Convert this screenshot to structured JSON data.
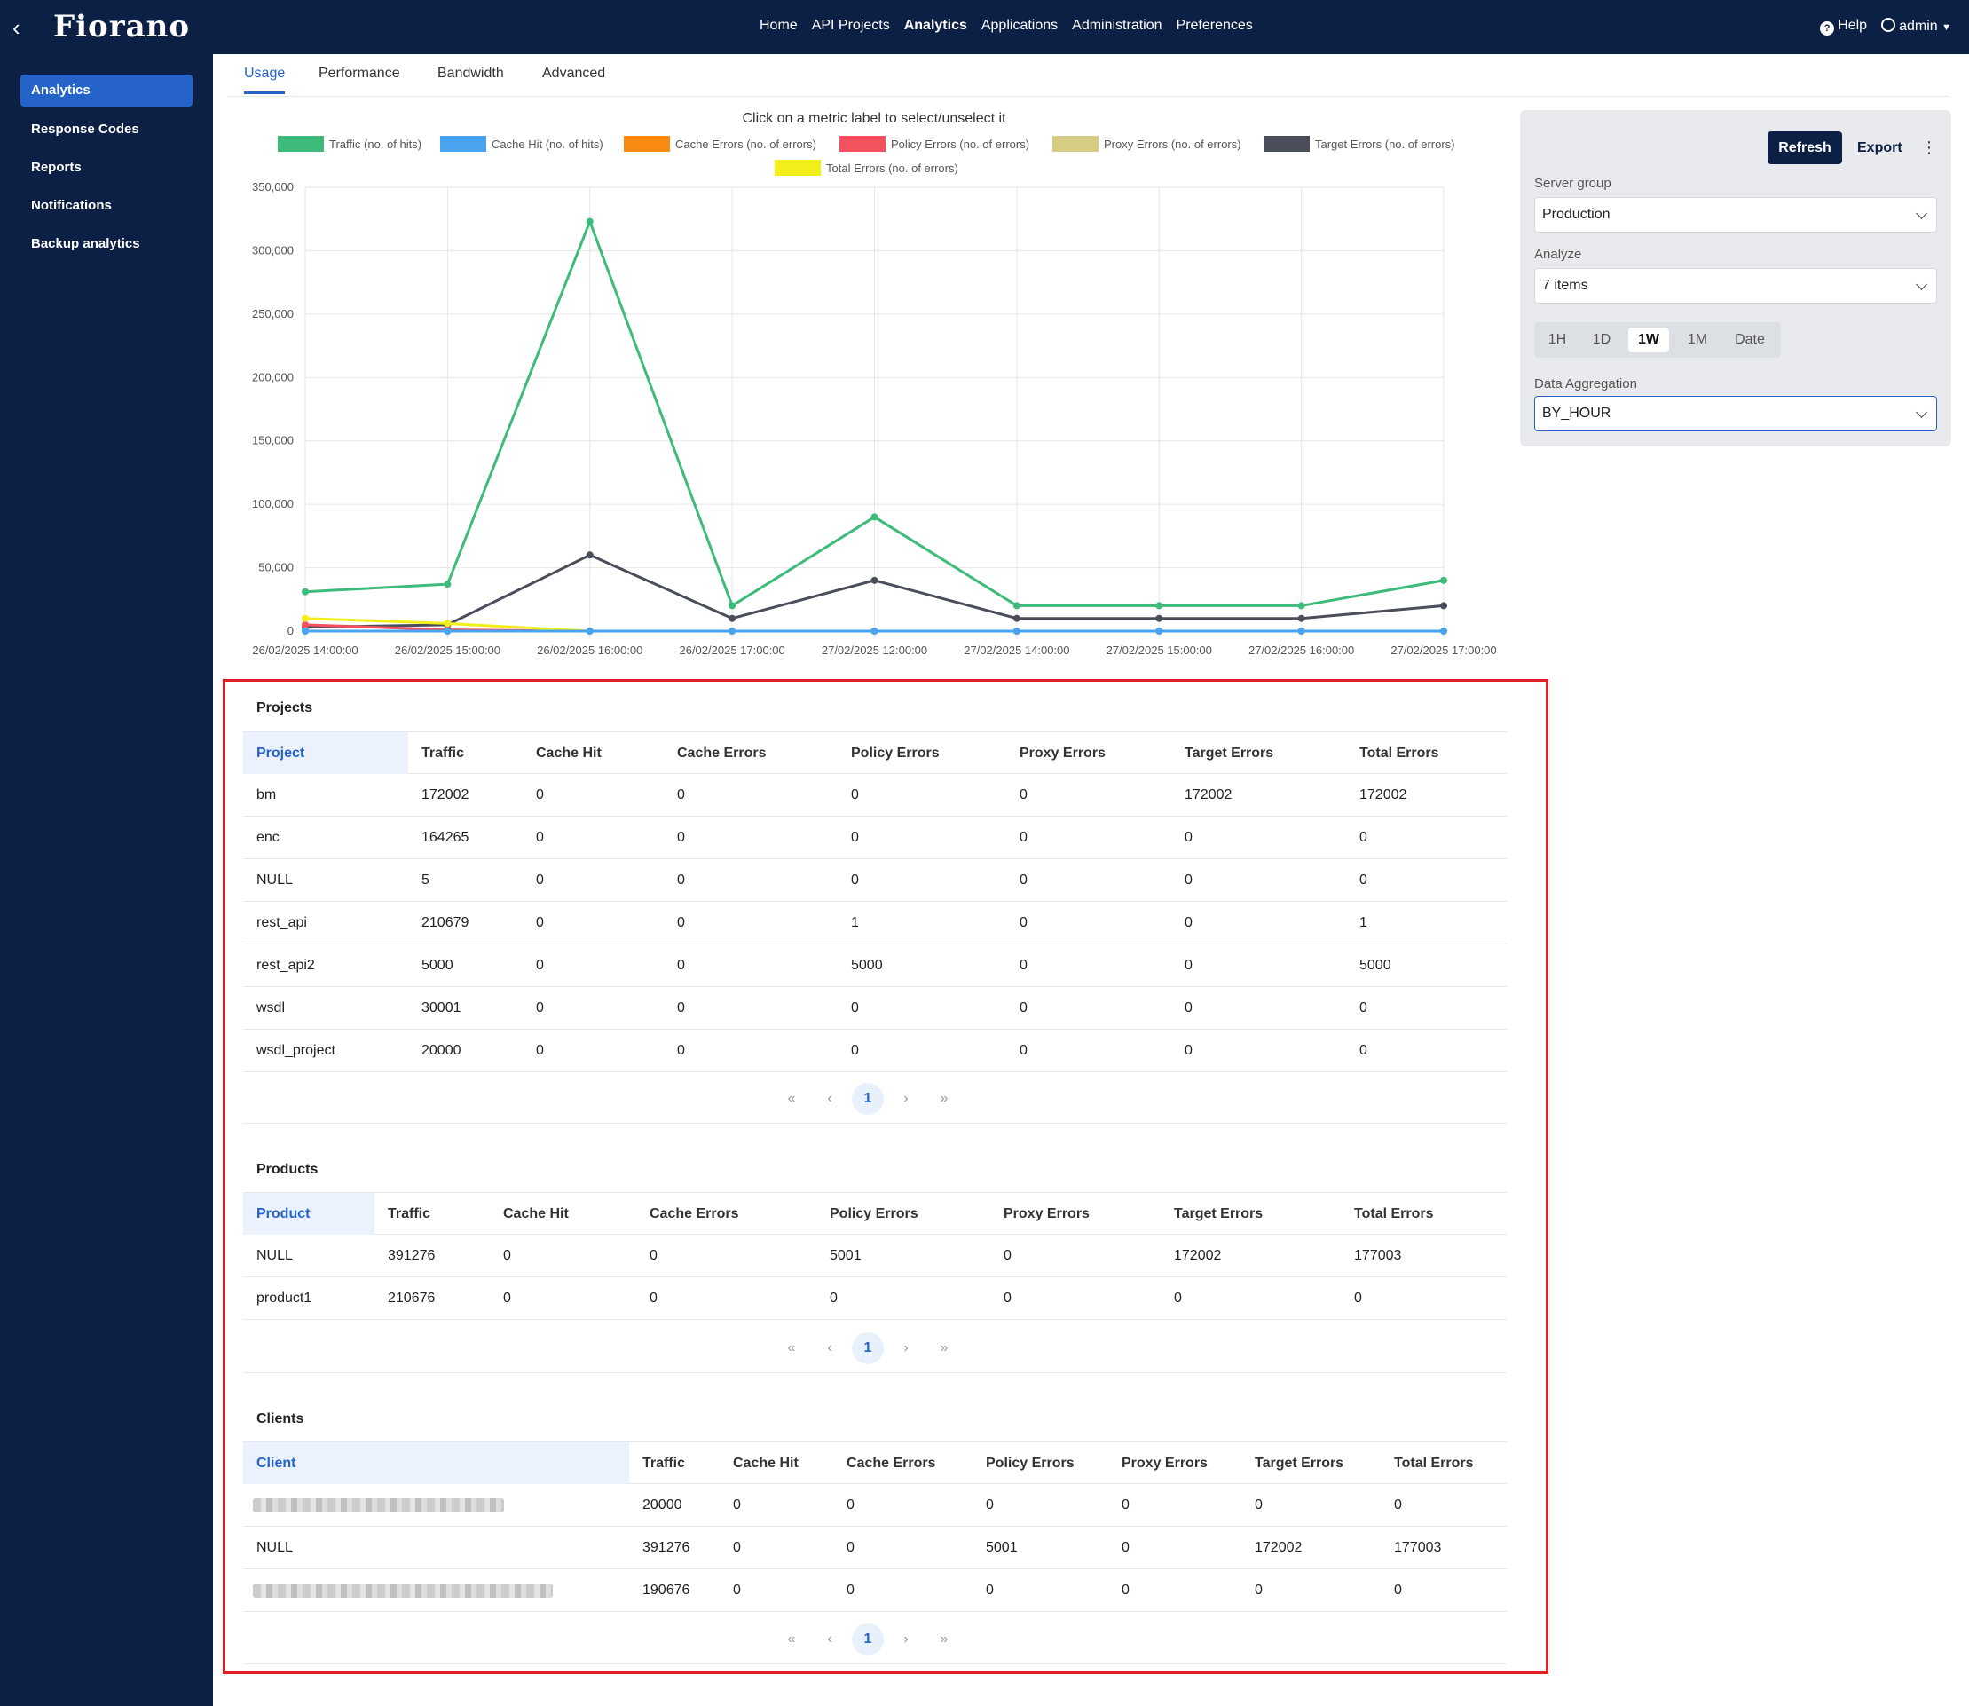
{
  "topbar": {
    "logo": "Fiorano",
    "nav": [
      "Home",
      "API Projects",
      "Analytics",
      "Applications",
      "Administration",
      "Preferences"
    ],
    "active_nav": "Analytics",
    "help": "Help",
    "user": "admin"
  },
  "sidebar": {
    "items": [
      {
        "label": "Analytics",
        "active": true
      },
      {
        "label": "Response Codes"
      },
      {
        "label": "Reports"
      },
      {
        "label": "Notifications"
      },
      {
        "label": "Backup analytics"
      }
    ]
  },
  "tabs": [
    "Usage",
    "Performance",
    "Bandwidth",
    "Advanced"
  ],
  "chart_title": "Click on a metric label to select/unselect it",
  "chart_data": {
    "type": "line",
    "categories": [
      "26/02/2025 14:00:00",
      "26/02/2025 15:00:00",
      "26/02/2025 16:00:00",
      "26/02/2025 17:00:00",
      "27/02/2025 12:00:00",
      "27/02/2025 14:00:00",
      "27/02/2025 15:00:00",
      "27/02/2025 16:00:00",
      "27/02/2025 17:00:00"
    ],
    "ylim": [
      0,
      350000
    ],
    "yticks": [
      "0",
      "50,000",
      "100,000",
      "150,000",
      "200,000",
      "250,000",
      "300,000",
      "350,000"
    ],
    "grid": true,
    "legend_position": "top",
    "series": [
      {
        "name": "Traffic (no. of hits)",
        "color": "#3dbb7b",
        "values": [
          31000,
          37000,
          323000,
          20000,
          90000,
          20000,
          20000,
          20000,
          40000
        ]
      },
      {
        "name": "Cache Hit (no. of hits)",
        "color": "#48a3f0",
        "values": [
          0,
          0,
          0,
          0,
          0,
          0,
          0,
          0,
          0
        ]
      },
      {
        "name": "Cache Errors (no. of errors)",
        "color": "#f98b13",
        "values": [
          0,
          0,
          0,
          0,
          0,
          0,
          0,
          0,
          0
        ]
      },
      {
        "name": "Policy Errors (no. of errors)",
        "color": "#f2515e",
        "values": [
          5000,
          1000,
          0,
          0,
          0,
          0,
          0,
          0,
          0
        ]
      },
      {
        "name": "Proxy Errors (no. of errors)",
        "color": "#d6cc82",
        "values": [
          0,
          0,
          0,
          0,
          0,
          0,
          0,
          0,
          0
        ]
      },
      {
        "name": "Target Errors (no. of errors)",
        "color": "#4a4e5a",
        "values": [
          3000,
          5000,
          60000,
          10000,
          40000,
          10000,
          10000,
          10000,
          20000
        ]
      },
      {
        "name": "Total Errors (no. of errors)",
        "color": "#f2ee1a",
        "values": [
          10000,
          6000,
          0,
          0,
          0,
          0,
          0,
          0,
          0
        ]
      }
    ]
  },
  "panel": {
    "refresh": "Refresh",
    "export": "Export",
    "kebab": "⋮",
    "server_group_label": "Server group",
    "server_group_value": "Production",
    "analyze_label": "Analyze",
    "analyze_value": "7 items",
    "ranges": [
      "1H",
      "1D",
      "1W",
      "1M",
      "Date"
    ],
    "active_range": "1W",
    "aggregation_label": "Data Aggregation",
    "aggregation_value": "BY_HOUR"
  },
  "pager": {
    "first": "«",
    "prev": "‹",
    "page": "1",
    "next": "›",
    "last": "»"
  },
  "tables": {
    "projects": {
      "title": "Projects",
      "headers": [
        "Project",
        "Traffic",
        "Cache Hit",
        "Cache Errors",
        "Policy Errors",
        "Proxy Errors",
        "Target Errors",
        "Total Errors"
      ],
      "rows": [
        [
          "bm",
          "172002",
          "0",
          "0",
          "0",
          "0",
          "172002",
          "172002"
        ],
        [
          "enc",
          "164265",
          "0",
          "0",
          "0",
          "0",
          "0",
          "0"
        ],
        [
          "NULL",
          "5",
          "0",
          "0",
          "0",
          "0",
          "0",
          "0"
        ],
        [
          "rest_api",
          "210679",
          "0",
          "0",
          "1",
          "0",
          "0",
          "1"
        ],
        [
          "rest_api2",
          "5000",
          "0",
          "0",
          "5000",
          "0",
          "0",
          "5000"
        ],
        [
          "wsdl",
          "30001",
          "0",
          "0",
          "0",
          "0",
          "0",
          "0"
        ],
        [
          "wsdl_project",
          "20000",
          "0",
          "0",
          "0",
          "0",
          "0",
          "0"
        ]
      ]
    },
    "products": {
      "title": "Products",
      "headers": [
        "Product",
        "Traffic",
        "Cache Hit",
        "Cache Errors",
        "Policy Errors",
        "Proxy Errors",
        "Target Errors",
        "Total Errors"
      ],
      "rows": [
        [
          "NULL",
          "391276",
          "0",
          "0",
          "5001",
          "0",
          "172002",
          "177003"
        ],
        [
          "product1",
          "210676",
          "0",
          "0",
          "0",
          "0",
          "0",
          "0"
        ]
      ]
    },
    "clients": {
      "title": "Clients",
      "headers": [
        "Client",
        "Traffic",
        "Cache Hit",
        "Cache Errors",
        "Policy Errors",
        "Proxy Errors",
        "Target Errors",
        "Total Errors"
      ],
      "rows": [
        [
          "",
          "20000",
          "0",
          "0",
          "0",
          "0",
          "0",
          "0"
        ],
        [
          "NULL",
          "391276",
          "0",
          "0",
          "5001",
          "0",
          "172002",
          "177003"
        ],
        [
          "",
          "190676",
          "0",
          "0",
          "0",
          "0",
          "0",
          "0"
        ]
      ]
    }
  }
}
